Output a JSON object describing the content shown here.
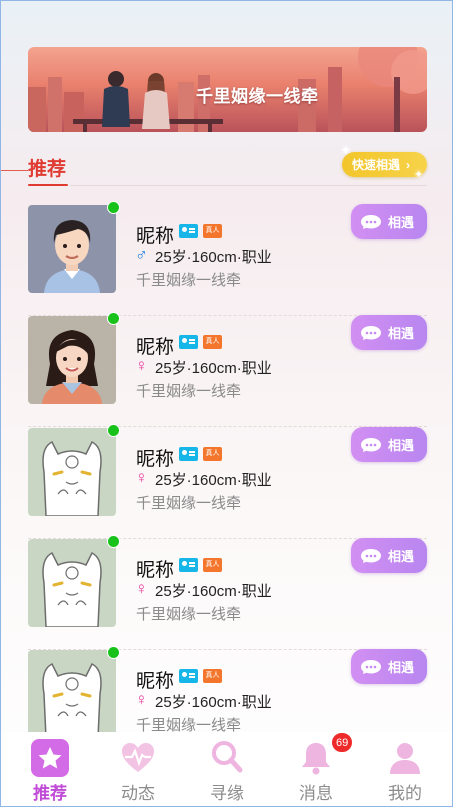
{
  "banner": {
    "title": "千里姻缘一线牵"
  },
  "section": {
    "title": "推荐",
    "quick_button": "快速相遇"
  },
  "profiles": [
    {
      "name": "昵称",
      "gender": "male",
      "gender_symbol": "♂",
      "info": "25岁·160cm·职业",
      "slogan": "千里姻缘一线牵",
      "button": "相遇",
      "badge_real": "真人",
      "avatar": "man-avatar"
    },
    {
      "name": "昵称",
      "gender": "female",
      "gender_symbol": "♀",
      "info": "25岁·160cm·职业",
      "slogan": "千里姻缘一线牵",
      "button": "相遇",
      "badge_real": "真人",
      "avatar": "woman-avatar"
    },
    {
      "name": "昵称",
      "gender": "female",
      "gender_symbol": "♀",
      "info": "25岁·160cm·职业",
      "slogan": "千里姻缘一线牵",
      "button": "相遇",
      "badge_real": "真人",
      "avatar": "cat-avatar"
    },
    {
      "name": "昵称",
      "gender": "female",
      "gender_symbol": "♀",
      "info": "25岁·160cm·职业",
      "slogan": "千里姻缘一线牵",
      "button": "相遇",
      "badge_real": "真人",
      "avatar": "cat-avatar"
    },
    {
      "name": "昵称",
      "gender": "female",
      "gender_symbol": "♀",
      "info": "25岁·160cm·职业",
      "slogan": "千里姻缘一线牵",
      "button": "相遇",
      "badge_real": "真人",
      "avatar": "cat-avatar"
    }
  ],
  "tabbar": {
    "items": [
      {
        "label": "推荐",
        "icon": "star-icon",
        "active": true
      },
      {
        "label": "动态",
        "icon": "heartbeat-icon",
        "active": false
      },
      {
        "label": "寻缘",
        "icon": "search-icon",
        "active": false
      },
      {
        "label": "消息",
        "icon": "bell-icon",
        "active": false,
        "badge": "69"
      },
      {
        "label": "我的",
        "icon": "user-icon",
        "active": false
      }
    ]
  },
  "colors": {
    "accent": "#c04bd6",
    "title_red": "#e03b33",
    "online": "#18c21a",
    "meet_button": "#c98af1",
    "quick_button": "#f2c52a"
  }
}
